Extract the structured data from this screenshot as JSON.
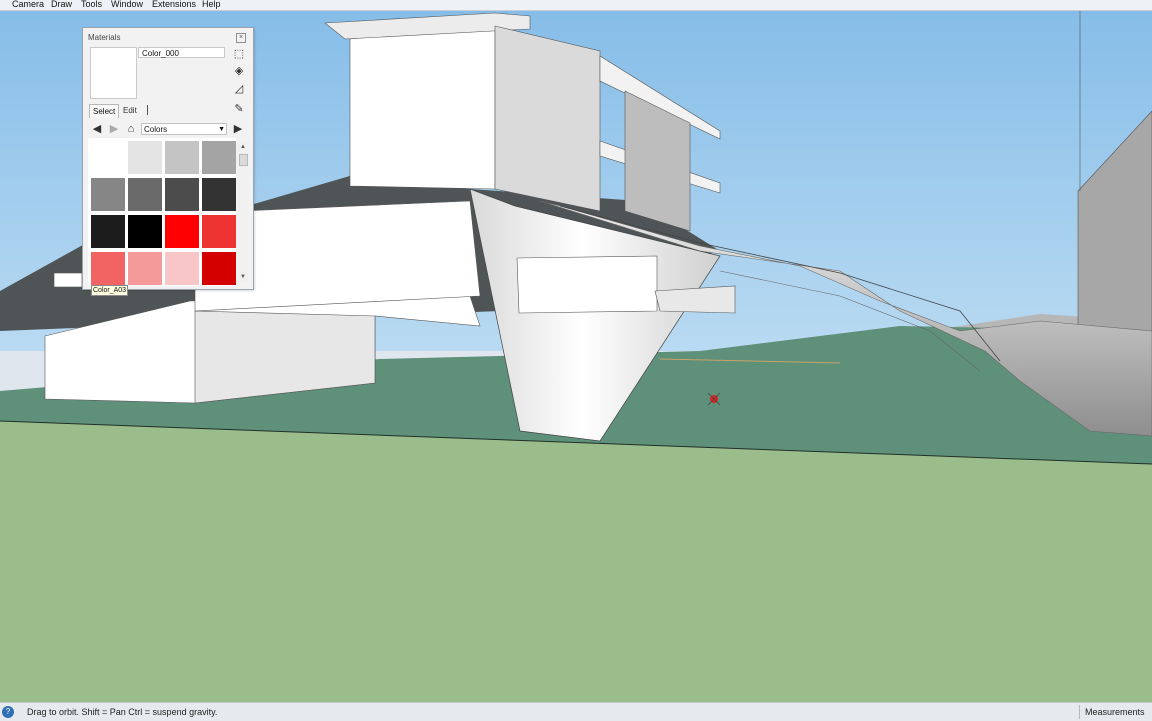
{
  "menu": {
    "items": [
      "Camera",
      "Draw",
      "Tools",
      "Window",
      "Extensions",
      "Help"
    ]
  },
  "materials_panel": {
    "title": "Materials",
    "material_name": "Color_000",
    "tabs": {
      "select": "Select",
      "edit": "Edit"
    },
    "library": "Colors",
    "swatches": [
      "#ffffff",
      "#e4e4e4",
      "#c4c4c4",
      "#a4a4a4",
      "#868686",
      "#6a6a6a",
      "#4c4c4c",
      "#333333",
      "#1c1c1c",
      "#000000",
      "#ff0000",
      "#ee3333",
      "#f26464",
      "#f59a9a",
      "#f8c6c6",
      "#d40000"
    ],
    "tooltip": "Color_A03"
  },
  "status": {
    "hint": "Drag to orbit. Shift = Pan  Ctrl = suspend gravity.",
    "measurements_label": "Measurements"
  },
  "colors": {
    "sky": "#8dc2ea",
    "ground": "#9bbd8c",
    "ground_dark": "#5c8f78"
  }
}
